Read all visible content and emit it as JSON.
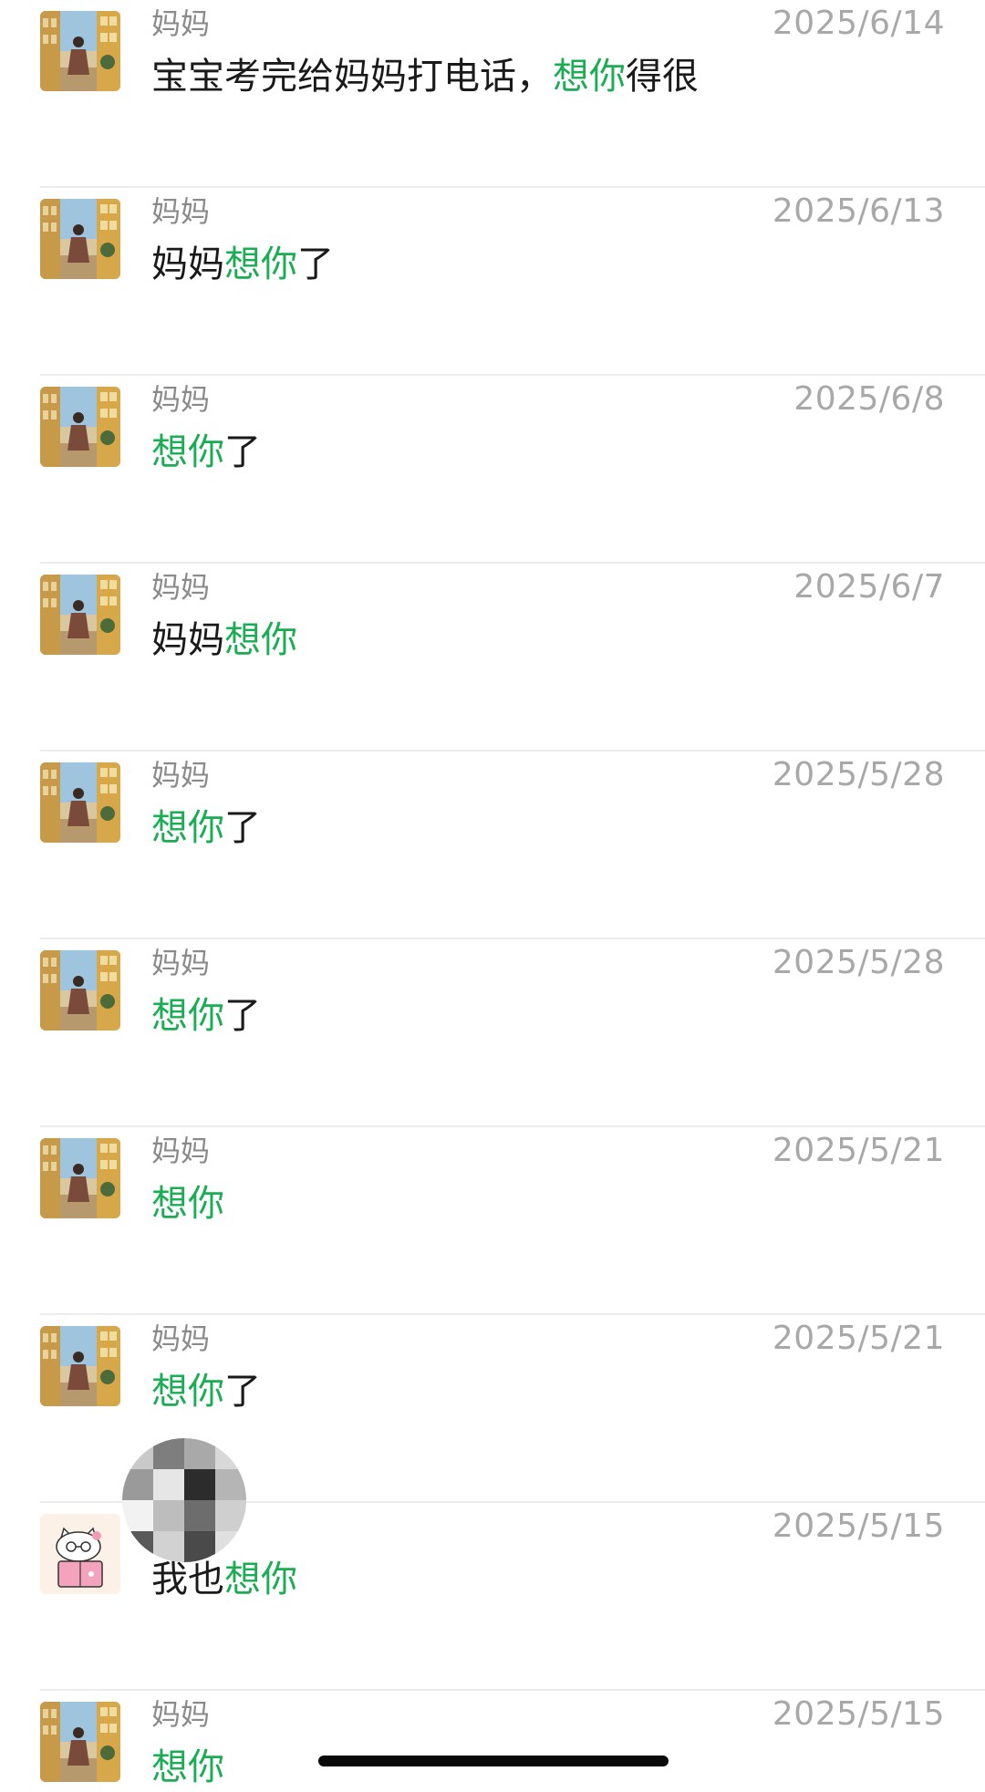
{
  "colors": {
    "highlight": "#1aad53",
    "text": "#1a1a1a",
    "sender": "#8a8a8a",
    "date": "#a8a8a8",
    "divider": "#ececec"
  },
  "results": [
    {
      "sender": "妈妈",
      "date": "2025/6/14",
      "avatar": "photo-avatar",
      "parts": [
        {
          "text": "宝宝考完给妈妈打电话，",
          "hl": false
        },
        {
          "text": "想你",
          "hl": true
        },
        {
          "text": "得很",
          "hl": false
        }
      ]
    },
    {
      "sender": "妈妈",
      "date": "2025/6/13",
      "avatar": "photo-avatar",
      "parts": [
        {
          "text": "妈妈",
          "hl": false
        },
        {
          "text": "想你",
          "hl": true
        },
        {
          "text": "了",
          "hl": false
        }
      ]
    },
    {
      "sender": "妈妈",
      "date": "2025/6/8",
      "avatar": "photo-avatar",
      "parts": [
        {
          "text": "想你",
          "hl": true
        },
        {
          "text": "了",
          "hl": false
        }
      ]
    },
    {
      "sender": "妈妈",
      "date": "2025/6/7",
      "avatar": "photo-avatar",
      "parts": [
        {
          "text": "妈妈",
          "hl": false
        },
        {
          "text": "想你",
          "hl": true
        }
      ]
    },
    {
      "sender": "妈妈",
      "date": "2025/5/28",
      "avatar": "photo-avatar",
      "parts": [
        {
          "text": "想你",
          "hl": true
        },
        {
          "text": "了",
          "hl": false
        }
      ]
    },
    {
      "sender": "妈妈",
      "date": "2025/5/28",
      "avatar": "photo-avatar",
      "parts": [
        {
          "text": "想你",
          "hl": true
        },
        {
          "text": "了",
          "hl": false
        }
      ]
    },
    {
      "sender": "妈妈",
      "date": "2025/5/21",
      "avatar": "photo-avatar",
      "parts": [
        {
          "text": "想你",
          "hl": true
        }
      ]
    },
    {
      "sender": "妈妈",
      "date": "2025/5/21",
      "avatar": "photo-avatar",
      "parts": [
        {
          "text": "想你",
          "hl": true
        },
        {
          "text": "了",
          "hl": false
        }
      ]
    },
    {
      "sender": "",
      "date": "2025/5/15",
      "avatar": "cartoon-cat-avatar",
      "parts": [
        {
          "text": "我也",
          "hl": false
        },
        {
          "text": "想你",
          "hl": true
        }
      ]
    },
    {
      "sender": "妈妈",
      "date": "2025/5/15",
      "avatar": "photo-avatar",
      "parts": [
        {
          "text": "想你",
          "hl": true
        }
      ]
    }
  ]
}
